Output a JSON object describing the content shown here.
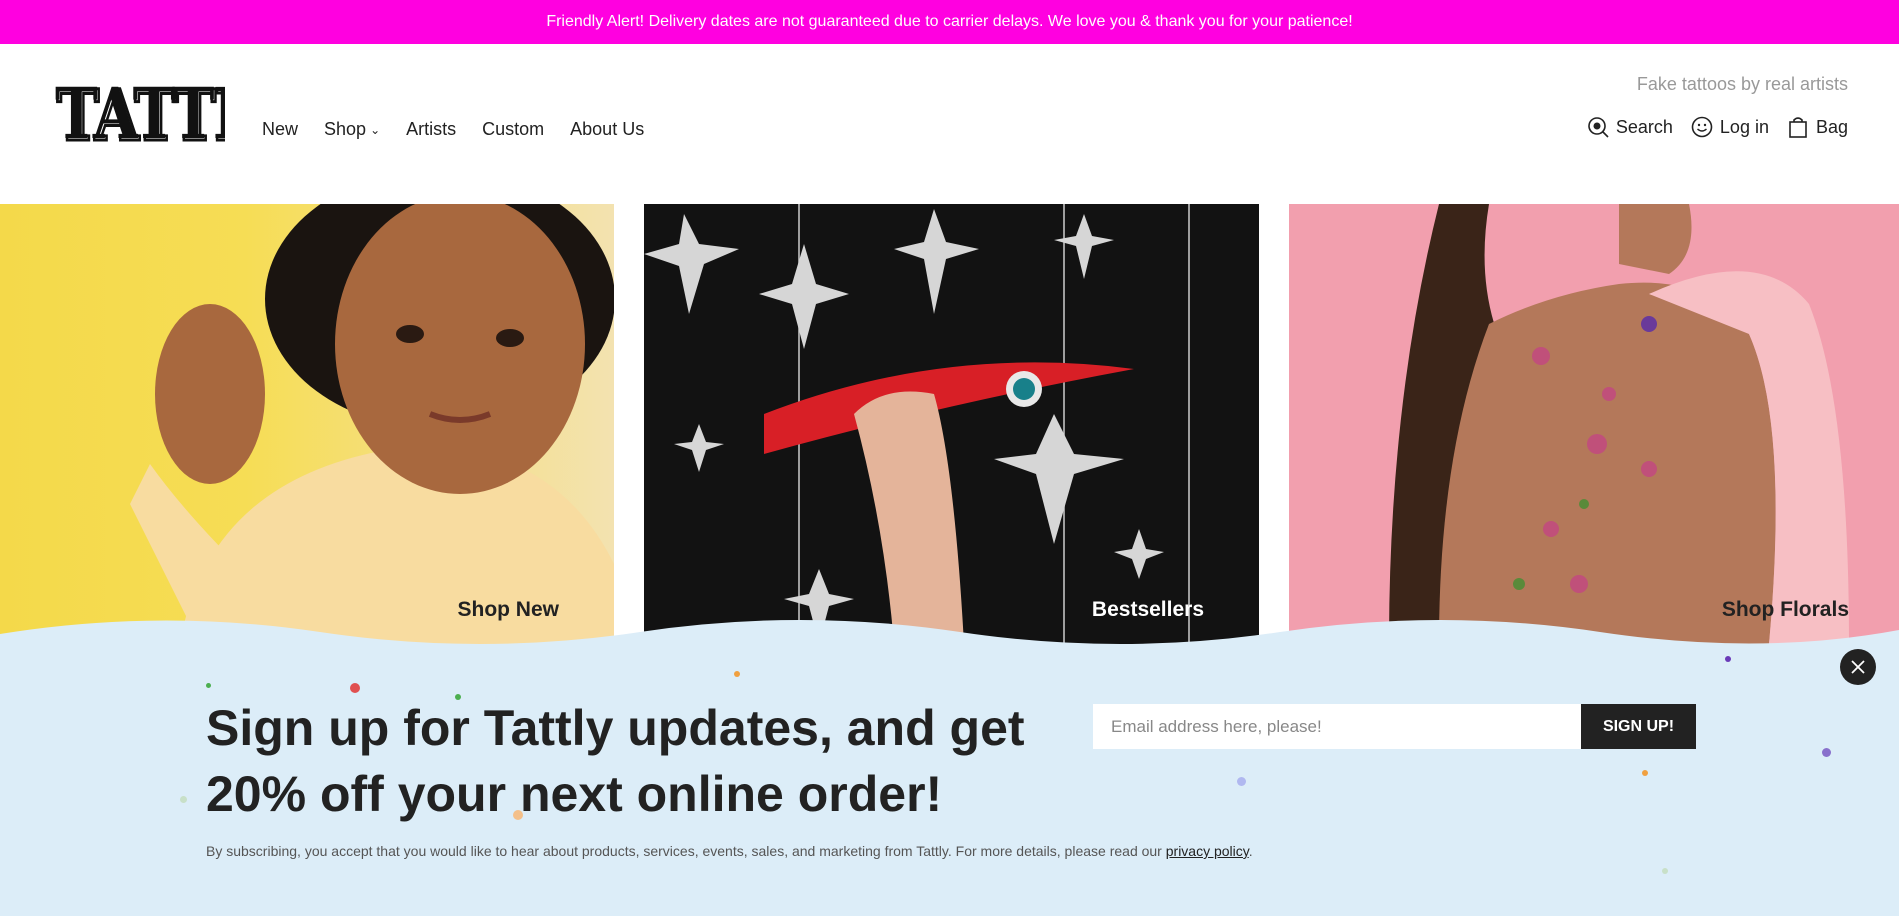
{
  "alert": {
    "text": "Friendly Alert! Delivery dates are not guaranteed due to carrier delays. We love you & thank you for your patience!"
  },
  "header": {
    "logo_text": "TATTLY",
    "tagline": "Fake tattoos by real artists",
    "nav": [
      {
        "label": "New"
      },
      {
        "label": "Shop"
      },
      {
        "label": "Artists"
      },
      {
        "label": "Custom"
      },
      {
        "label": "About Us"
      }
    ],
    "util": {
      "search": "Search",
      "login": "Log in",
      "bag": "Bag"
    }
  },
  "tiles": [
    {
      "label": "Shop New"
    },
    {
      "label": "Bestsellers"
    },
    {
      "label": "Shop Florals"
    }
  ],
  "signup": {
    "heading": "Sign up for Tattly updates, and get 20% off your next online order!",
    "email_placeholder": "Email address here, please!",
    "button_label": "SIGN UP!",
    "disclaimer": "By subscribing, you accept that you would like to hear about products, services, events, sales, and marketing from Tattly. For more details, please read our ",
    "privacy_link": "privacy policy",
    "disclaimer_end": "."
  },
  "colors": {
    "alert_bg": "#ff00e0",
    "popup_bg": "#dcedf8",
    "dark": "#222222"
  },
  "icons": [
    "search-icon",
    "smiley-icon",
    "bag-icon",
    "close-icon",
    "chevron-down-icon"
  ]
}
